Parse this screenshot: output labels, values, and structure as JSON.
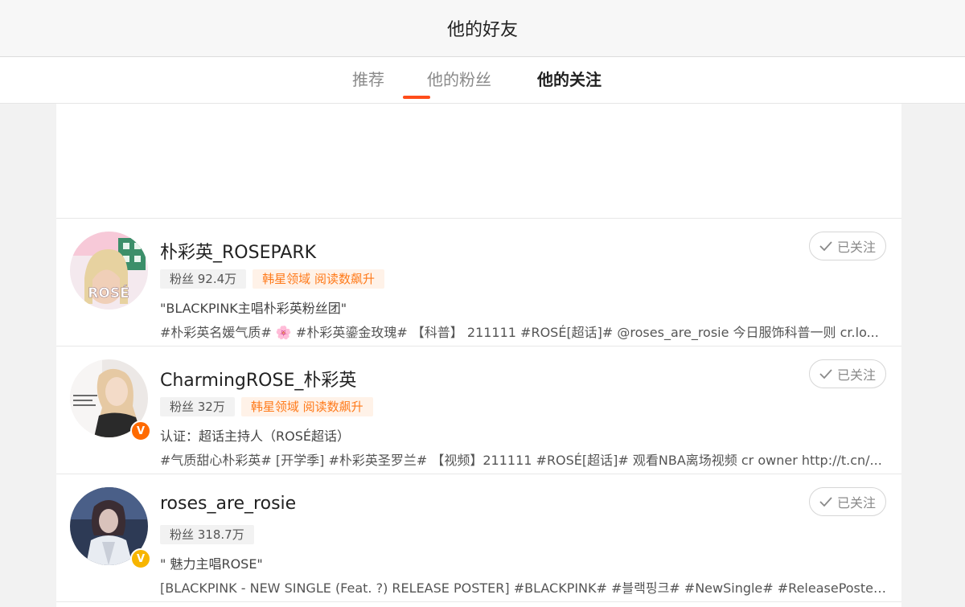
{
  "header": {
    "title": "他的好友"
  },
  "tabs": [
    {
      "label": "推荐"
    },
    {
      "label": "他的粉丝"
    },
    {
      "label": "他的关注"
    }
  ],
  "users": [
    {
      "name": "朴彩英_ROSEPARK",
      "fans": "粉丝 92.4万",
      "hot_tag": "韩星领域 阅读数飙升",
      "desc": "\"BLACKPINK主唱朴彩英粉丝团\"",
      "posts": "#朴彩英名媛气质# 🌸 #朴彩英鎏金玫瑰# 【科普】 211111 #ROSÉ[超话]# @roses_are_rosie 今日服饰科普一则 cr.lo...",
      "follow_label": "已关注",
      "avatar_text": "ROSÉ",
      "avatar_icon": "avatar"
    },
    {
      "name": "CharmingROSE_朴彩英",
      "fans": "粉丝 32万",
      "hot_tag": "韩星领域 阅读数飙升",
      "desc": "认证：超话主持人（ROSÉ超话）",
      "posts": "#气质甜心朴彩英# [开学季] #朴彩英圣罗兰# 【视频】211111 #ROSÉ[超话]# 观看NBA离场视频 cr owner http://t.cn/...",
      "follow_label": "已关注",
      "verify_mark": "V",
      "verify_color": "#ff6a00"
    },
    {
      "name": "roses_are_rosie",
      "fans": "粉丝 318.7万",
      "desc": "\" 魅力主唱ROSE\"",
      "posts": "[BLACKPINK - NEW SINGLE (Feat. ?) RELEASE POSTER] #BLACKPINK# #블랙핑크# #NewSingle# #ReleasePoster...",
      "follow_label": "已关注",
      "verify_mark": "V",
      "verify_color": "#f7b500"
    }
  ],
  "colors": {
    "accent": "#ff4d1a",
    "hot_tag_text": "#ff7a1a",
    "hot_tag_bg": "#fff2e8"
  }
}
